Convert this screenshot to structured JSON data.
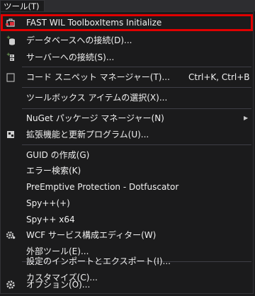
{
  "menubar": {
    "title": "ツール(T)"
  },
  "menu": {
    "items": [
      {
        "label": "FAST WIL ToolboxItems Initialize",
        "icon": "toolbox-plugin-icon"
      },
      {
        "label": "データベースへの接続(D)...",
        "icon": "database-connect-icon"
      },
      {
        "label": "サーバーへの接続(S)...",
        "icon": "server-connect-icon"
      },
      {
        "label": "コード スニペット マネージャー(T)...",
        "shortcut": "Ctrl+K, Ctrl+B",
        "icon": "snippet-icon"
      },
      {
        "label": "ツールボックス アイテムの選択(X)..."
      },
      {
        "label": "NuGet パッケージ マネージャー(N)",
        "submenu": true
      },
      {
        "label": "拡張機能と更新プログラム(U)...",
        "icon": "extensions-icon"
      },
      {
        "label": "GUID の作成(G)"
      },
      {
        "label": "エラー検索(K)"
      },
      {
        "label": "PreEmptive Protection - Dotfuscator"
      },
      {
        "label": "Spy++(+)"
      },
      {
        "label": "Spy++ x64"
      },
      {
        "label": "WCF サービス構成エディター(W)",
        "icon": "wcf-gear-icon"
      },
      {
        "label": "外部ツール(E)..."
      },
      {
        "label": "設定のインポートとエクスポート(I)..."
      },
      {
        "label": "カスタマイズ(C)..."
      },
      {
        "label": "オプション(O)...",
        "icon": "options-gear-icon"
      }
    ]
  },
  "colors": {
    "highlight_border": "#e00000",
    "background": "#1b1b1c",
    "text": "#f1f1f1"
  }
}
